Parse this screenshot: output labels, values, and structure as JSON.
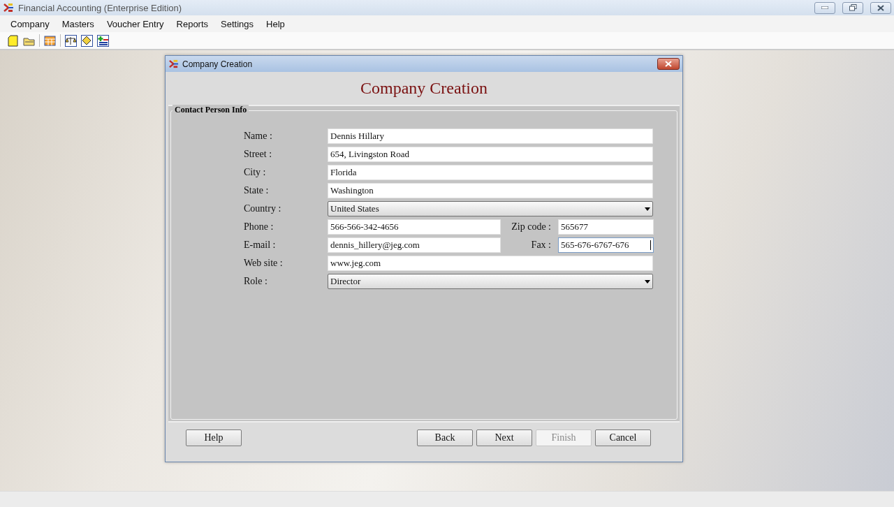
{
  "window": {
    "title": "Financial Accounting (Enterprise Edition)"
  },
  "menu": [
    "Company",
    "Masters",
    "Voucher Entry",
    "Reports",
    "Settings",
    "Help"
  ],
  "dialog": {
    "title": "Company Creation",
    "heading": "Company Creation",
    "group_title": "Contact Person Info",
    "rows": [
      {
        "fields": [
          {
            "label": "Name :",
            "value": "Dennis Hillary",
            "kind": "text",
            "focused": false
          }
        ]
      },
      {
        "fields": [
          {
            "label": "Street :",
            "value": "654, Livingston Road",
            "kind": "text",
            "focused": false
          }
        ]
      },
      {
        "fields": [
          {
            "label": "City :",
            "value": "Florida",
            "kind": "text",
            "focused": false
          }
        ]
      },
      {
        "fields": [
          {
            "label": "State :",
            "value": "Washington",
            "kind": "text",
            "focused": false
          }
        ]
      },
      {
        "fields": [
          {
            "label": "Country :",
            "value": "United States",
            "kind": "select",
            "focused": false
          }
        ]
      },
      {
        "fields": [
          {
            "label": "Phone :",
            "value": "566-566-342-4656",
            "kind": "text",
            "focused": false
          },
          {
            "label": "Zip code :",
            "value": "565677",
            "kind": "text",
            "focused": false
          }
        ]
      },
      {
        "fields": [
          {
            "label": "E-mail :",
            "value": "dennis_hillery@jeg.com",
            "kind": "text",
            "focused": false
          },
          {
            "label": "Fax :",
            "value": "565-676-6767-676",
            "kind": "text",
            "focused": true
          }
        ]
      },
      {
        "fields": [
          {
            "label": "Web site :",
            "value": "www.jeg.com",
            "kind": "text",
            "focused": false
          }
        ]
      },
      {
        "fields": [
          {
            "label": "Role :",
            "value": "Director",
            "kind": "select",
            "focused": false
          }
        ]
      }
    ],
    "buttons": [
      {
        "label": "Help",
        "disabled": false
      },
      {
        "label": "Back",
        "disabled": false
      },
      {
        "label": "Next",
        "disabled": false
      },
      {
        "label": "Finish",
        "disabled": true
      },
      {
        "label": "Cancel",
        "disabled": false
      }
    ]
  }
}
